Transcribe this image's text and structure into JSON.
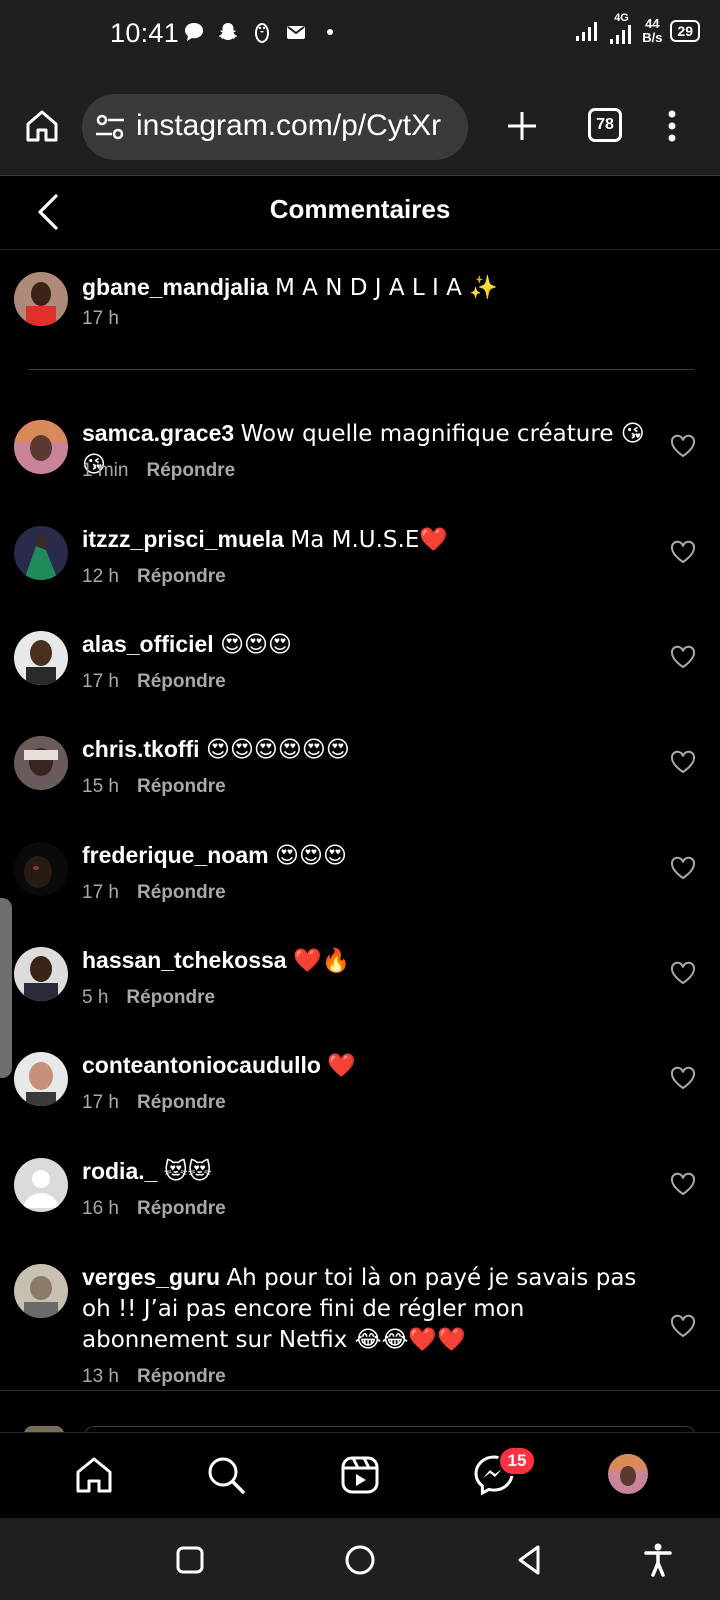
{
  "status_bar": {
    "time": "10:41",
    "network": "4G",
    "speed_value": "44",
    "speed_unit": "B/s",
    "battery": "29",
    "notification_icons": [
      "chat-bubble-icon",
      "snapchat-icon",
      "penguin-icon",
      "mail-icon",
      "dot-icon"
    ]
  },
  "browser": {
    "url": "instagram.com/p/CytXr",
    "tabs_count": "78"
  },
  "header": {
    "title": "Commentaires"
  },
  "caption": {
    "username": "gbane_mandjalia",
    "text": "M A N D J A L I A ✨",
    "time": "17 h"
  },
  "comments": [
    {
      "username": "samca.grace3",
      "text": "Wow quelle magnifique créature 😘😘",
      "time": "1 min",
      "reply": "Répondre"
    },
    {
      "username": "itzzz_prisci_muela",
      "text": "Ma M.U.S.E❤️",
      "time": "12 h",
      "reply": "Répondre"
    },
    {
      "username": "alas_officiel",
      "text": "😍😍😍",
      "time": "17 h",
      "reply": "Répondre"
    },
    {
      "username": "chris.tkoffi",
      "text": "😍😍😍😍😍😍",
      "time": "15 h",
      "reply": "Répondre"
    },
    {
      "username": "frederique_noam",
      "text": "😍😍😍",
      "time": "17 h",
      "reply": "Répondre"
    },
    {
      "username": "hassan_tchekossa",
      "text": "❤️🔥",
      "time": "5 h",
      "reply": "Répondre"
    },
    {
      "username": "conteantoniocaudullo",
      "text": "❤️",
      "time": "17 h",
      "reply": "Répondre"
    },
    {
      "username": "rodia._",
      "text": "😻😻",
      "time": "16 h",
      "reply": "Répondre"
    },
    {
      "username": "verges_guru",
      "text": "Ah pour toi là on payé je savais pas oh !! J’ai pas encore fini de régler mon abonnement sur Netfix 😂😂❤️❤️",
      "time": "13 h",
      "reply": "Répondre"
    }
  ],
  "bottom_nav": {
    "messages_badge": "15",
    "items": [
      "home-icon",
      "search-icon",
      "reels-icon",
      "messenger-icon",
      "profile-avatar"
    ]
  },
  "colors": {
    "background": "#000000",
    "chrome": "#1f1f1f",
    "secondary_text": "#a8a8a8",
    "badge": "#ff3040",
    "heart_red": "#e0245e"
  }
}
